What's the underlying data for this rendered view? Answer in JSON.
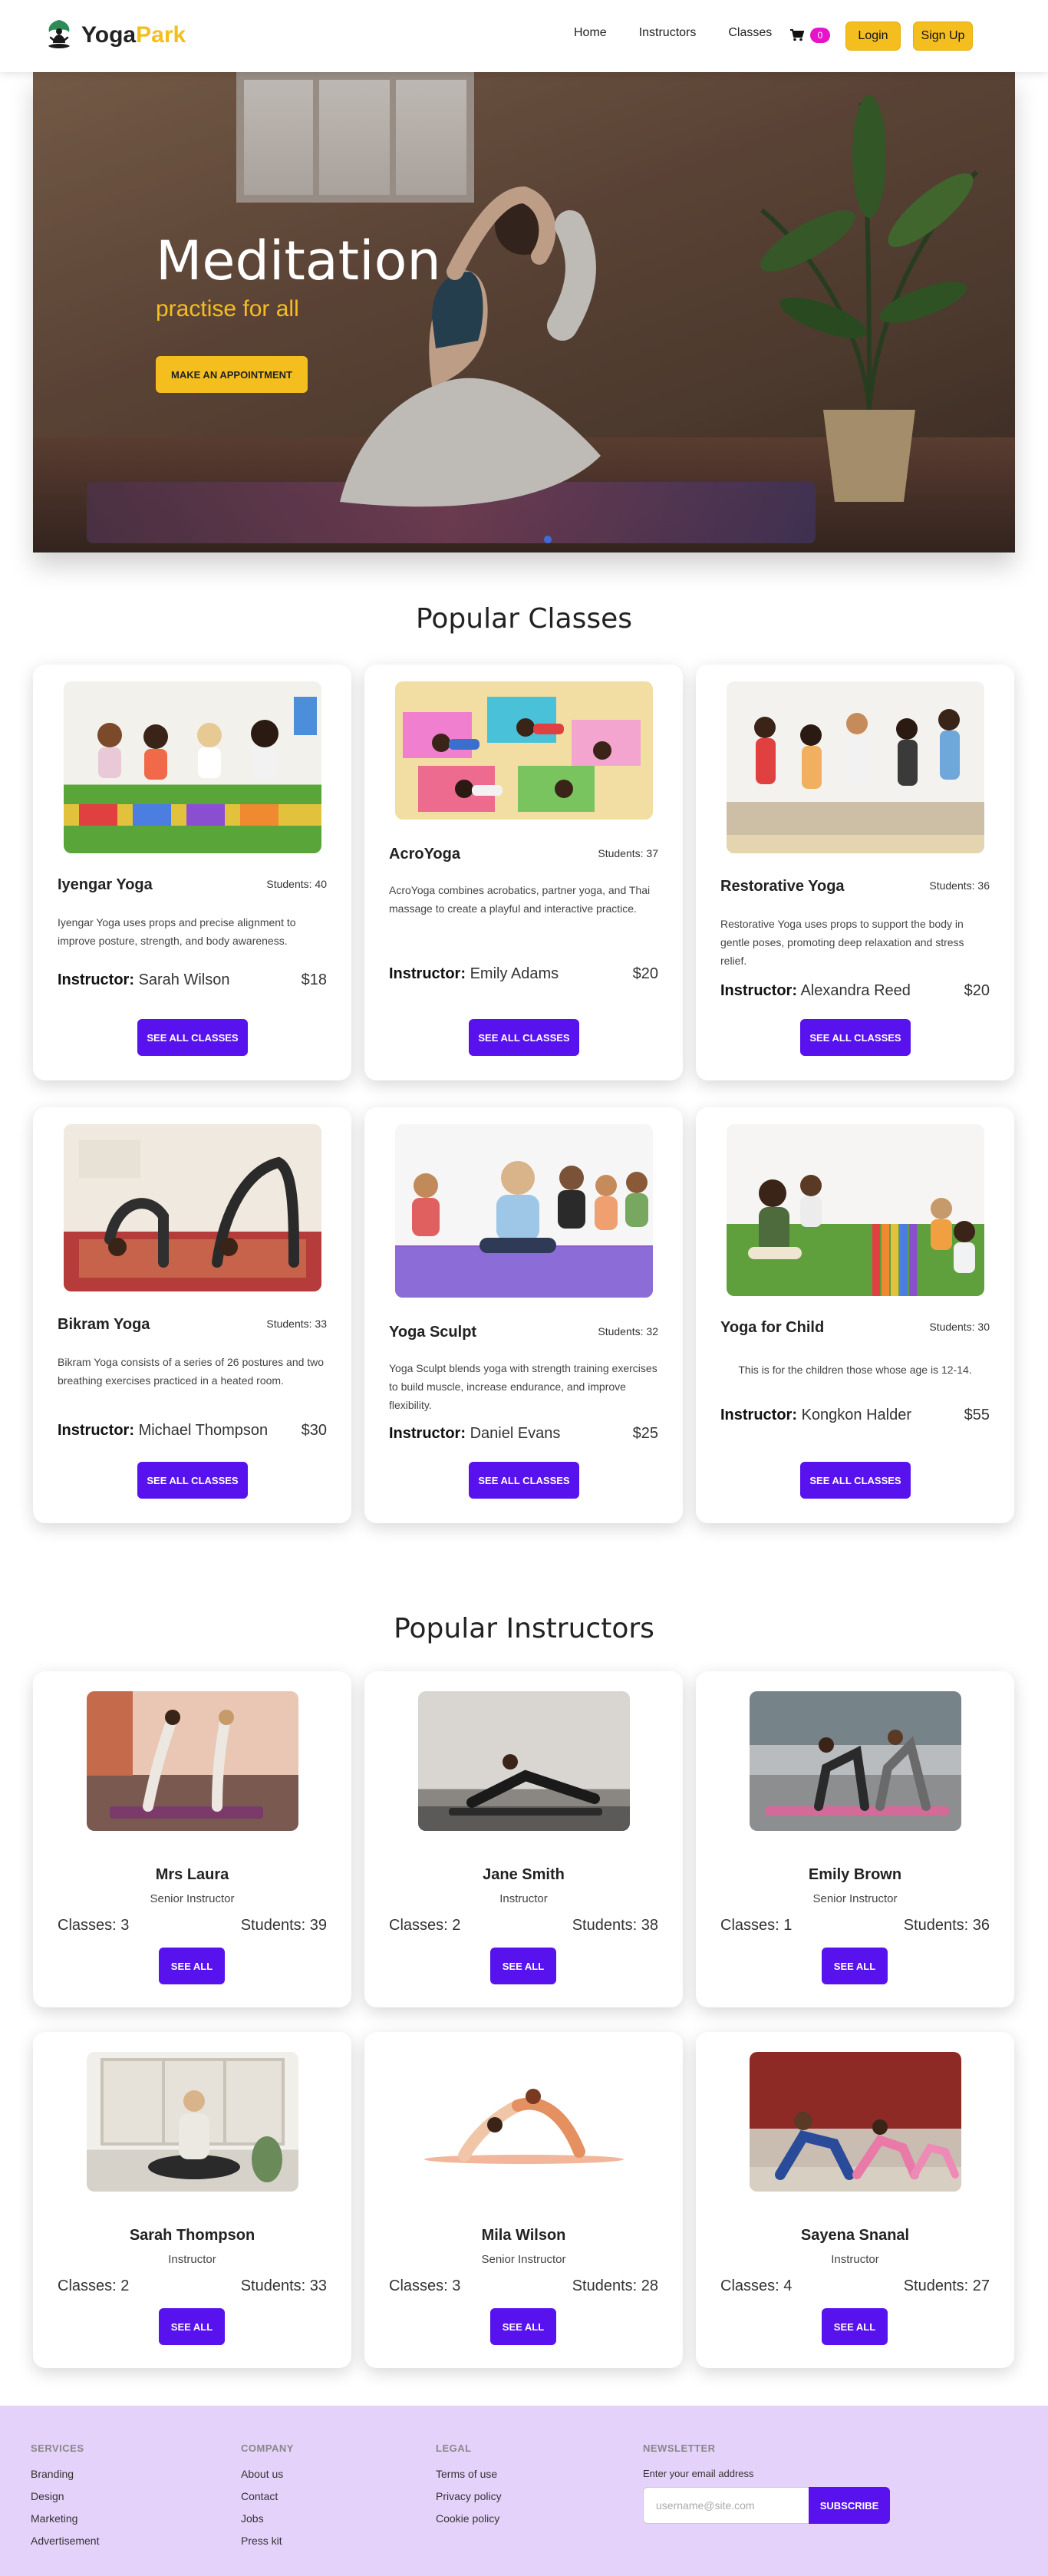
{
  "nav": {
    "logo_main": "Yoga",
    "logo_accent": "Park",
    "links": [
      "Home",
      "Instructors",
      "Classes"
    ],
    "cart_count": "0",
    "login": "Login",
    "signup": "Sign Up"
  },
  "hero": {
    "title": "Meditation",
    "subtitle": "practise for all",
    "button": "MAKE AN APPOINTMENT"
  },
  "classes": {
    "title": "Popular Classes",
    "items": [
      {
        "name": "Iyengar Yoga",
        "students": "Students: 40",
        "desc": "Iyengar Yoga uses props and precise alignment to improve posture, strength, and body awareness.",
        "instructor_label": "Instructor:",
        "instructor": "Sarah Wilson",
        "price": "$18",
        "button": "SEE ALL CLASSES"
      },
      {
        "name": "AcroYoga",
        "students": "Students: 37",
        "desc": "AcroYoga combines acrobatics, partner yoga, and Thai massage to create a playful and interactive practice.",
        "instructor_label": "Instructor:",
        "instructor": "Emily Adams",
        "price": "$20",
        "button": "SEE ALL CLASSES"
      },
      {
        "name": "Restorative Yoga",
        "students": "Students: 36",
        "desc": "Restorative Yoga uses props to support the body in gentle poses, promoting deep relaxation and stress relief.",
        "instructor_label": "Instructor:",
        "instructor": "Alexandra Reed",
        "price": "$20",
        "button": "SEE ALL CLASSES"
      },
      {
        "name": "Bikram Yoga",
        "students": "Students: 33",
        "desc": "Bikram Yoga consists of a series of 26 postures and two breathing exercises practiced in a heated room.",
        "instructor_label": "Instructor:",
        "instructor": "Michael Thompson",
        "price": "$30",
        "button": "SEE ALL CLASSES"
      },
      {
        "name": "Yoga Sculpt",
        "students": "Students: 32",
        "desc": "Yoga Sculpt blends yoga with strength training exercises to build muscle, increase endurance, and improve flexibility.",
        "instructor_label": "Instructor:",
        "instructor": "Daniel Evans",
        "price": "$25",
        "button": "SEE ALL CLASSES"
      },
      {
        "name": "Yoga for Child",
        "students": "Students: 30",
        "desc": "This is for the children those whose age is 12-14.",
        "instructor_label": "Instructor:",
        "instructor": "Kongkon Halder",
        "price": "$55",
        "button": "SEE ALL CLASSES"
      }
    ]
  },
  "instructors": {
    "title": "Popular Instructors",
    "items": [
      {
        "name": "Mrs Laura",
        "role": "Senior Instructor",
        "classes": "Classes: 3",
        "students": "Students: 39",
        "button": "SEE ALL"
      },
      {
        "name": "Jane Smith",
        "role": "Instructor",
        "classes": "Classes: 2",
        "students": "Students: 38",
        "button": "SEE ALL"
      },
      {
        "name": "Emily Brown",
        "role": "Senior Instructor",
        "classes": "Classes: 1",
        "students": "Students: 36",
        "button": "SEE ALL"
      },
      {
        "name": "Sarah Thompson",
        "role": "Instructor",
        "classes": "Classes: 2",
        "students": "Students: 33",
        "button": "SEE ALL"
      },
      {
        "name": "Mila Wilson",
        "role": "Senior Instructor",
        "classes": "Classes: 3",
        "students": "Students: 28",
        "button": "SEE ALL"
      },
      {
        "name": "Sayena Snanal",
        "role": "Instructor",
        "classes": "Classes: 4",
        "students": "Students: 27",
        "button": "SEE ALL"
      }
    ]
  },
  "footer": {
    "services": {
      "title": "SERVICES",
      "links": [
        "Branding",
        "Design",
        "Marketing",
        "Advertisement"
      ]
    },
    "company": {
      "title": "COMPANY",
      "links": [
        "About us",
        "Contact",
        "Jobs",
        "Press kit"
      ]
    },
    "legal": {
      "title": "LEGAL",
      "links": [
        "Terms of use",
        "Privacy policy",
        "Cookie policy"
      ]
    },
    "newsletter": {
      "title": "NEWSLETTER",
      "label": "Enter your email address",
      "placeholder": "username@site.com",
      "button": "SUBSCRIBE"
    }
  },
  "colors": {
    "accent_yellow": "#f5be1f",
    "primary_purple": "#5812ed",
    "footer_bg": "#e5d2fb",
    "cart_badge": "#e613c9"
  }
}
